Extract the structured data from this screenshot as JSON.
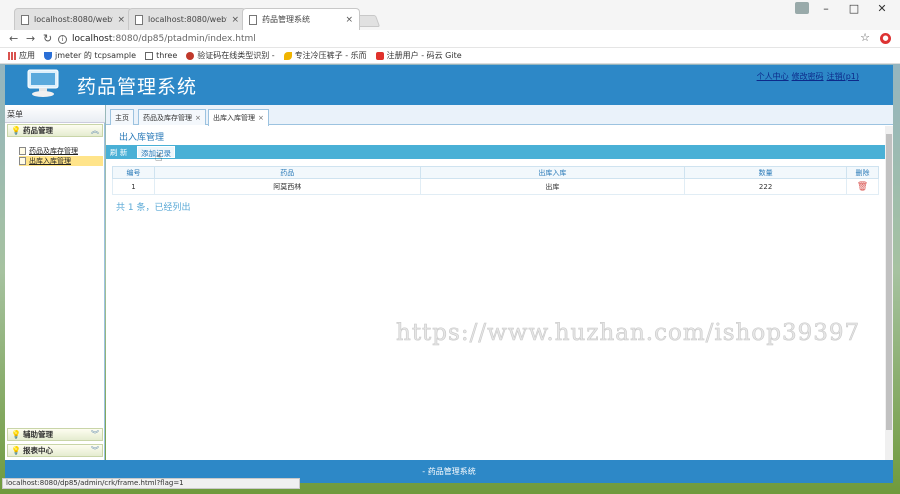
{
  "browser": {
    "tabs": [
      {
        "title": "localhost:8080/webtoo"
      },
      {
        "title": "localhost:8080/webtoo"
      },
      {
        "title": "药品管理系统"
      }
    ],
    "tab_close": "×",
    "url_host": "localhost",
    "url_path": ":8080/dp85/ptadmin/index.html",
    "bookmarks": [
      {
        "label": "应用",
        "icon": "apps-grid-icon"
      },
      {
        "label": "jmeter 的 tcpsample",
        "icon": "shield-icon"
      },
      {
        "label": "three",
        "icon": "page-icon"
      },
      {
        "label": "验证码在线类型识别 -",
        "icon": "globe-icon"
      },
      {
        "label": "专注冷压裤子 - 乐而",
        "icon": "bird-icon"
      },
      {
        "label": "注册用户 - 码云 Gite",
        "icon": "gitee-icon"
      }
    ],
    "status_url": "localhost:8080/dp85/admin/crk/frame.html?flag=1"
  },
  "header": {
    "title": "药品管理系统",
    "links": [
      "个人中心",
      "修改密码",
      "注销(p1)"
    ]
  },
  "sidebar": {
    "title": "菜单",
    "groups": [
      {
        "label": "药品管理",
        "items": [
          "药品及库存管理",
          "出库入库管理"
        ]
      },
      {
        "label": "辅助管理"
      },
      {
        "label": "报表中心"
      }
    ]
  },
  "content": {
    "tabs": [
      "主页",
      "药品及库存管理",
      "出库入库管理"
    ],
    "frame_title": "出入库管理",
    "actions": {
      "refresh": "刷 新",
      "add": "添加记录"
    },
    "table": {
      "columns": [
        "编号",
        "药品",
        "出库入库",
        "数量",
        "删除"
      ],
      "rows": [
        {
          "id": "1",
          "drug": "阿莫西林",
          "type": "出库",
          "qty": "222"
        }
      ]
    },
    "pager": "共 1 条，已经列出",
    "watermark": "https://www.huzhan.com/ishop39397"
  },
  "footer": {
    "text": "- 药品管理系统"
  }
}
